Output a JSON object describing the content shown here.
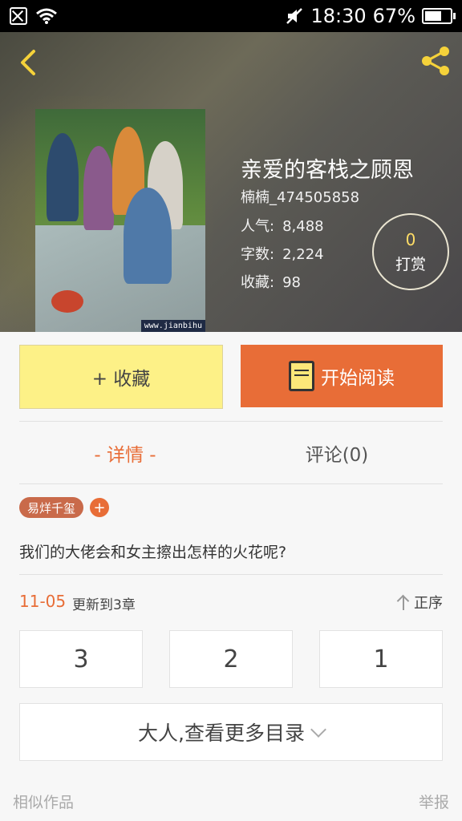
{
  "status_bar": {
    "time": "18:30",
    "battery_percent": "67%",
    "battery_level": 0.67
  },
  "book": {
    "title": "亲爱的客栈之顾恩",
    "author": "楠楠_474505858",
    "popularity_label": "人气:",
    "popularity_value": "8,488",
    "wordcount_label": "字数:",
    "wordcount_value": "2,224",
    "favorites_label": "收藏:",
    "favorites_value": "98",
    "cover_watermark": "www.jianbihu"
  },
  "tip": {
    "count": "0",
    "label": "打赏"
  },
  "actions": {
    "favorite_label": "+ 收藏",
    "read_label": "开始阅读"
  },
  "tabs": {
    "detail": "- 详情 -",
    "comments": "评论(0)"
  },
  "tag": {
    "name": "易烊千玺",
    "add": "+"
  },
  "description": "我们的大佬会和女主擦出怎样的火花呢?",
  "update": {
    "date": "11-05",
    "text": "更新到3章",
    "order_label": "正序"
  },
  "chapters": [
    "3",
    "2",
    "1"
  ],
  "more_label": "大人,查看更多目录",
  "footer": {
    "similar": "相似作品",
    "report": "举报"
  },
  "colors": {
    "accent": "#e86d37",
    "favorite_bg": "#fdf187"
  }
}
